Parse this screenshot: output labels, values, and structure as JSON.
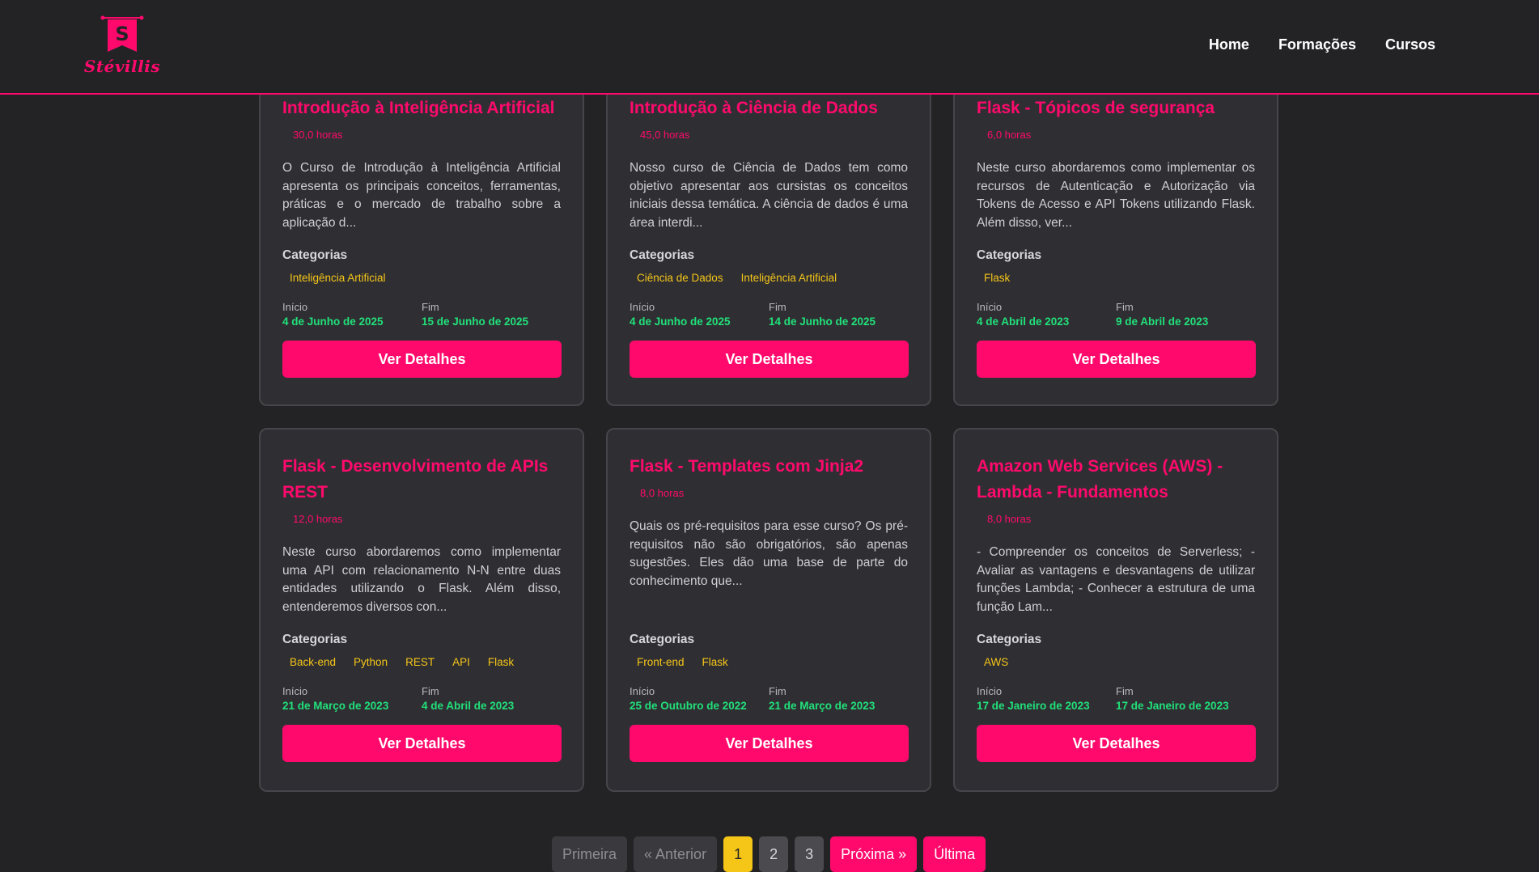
{
  "brand": {
    "name": "Stévillis",
    "letter": "S",
    "color": "#ff0a6c"
  },
  "nav": {
    "items": [
      "Home",
      "Formações",
      "Cursos"
    ]
  },
  "labels": {
    "categorias": "Categorias",
    "inicio": "Início",
    "fim": "Fim",
    "button": "Ver Detalhes"
  },
  "courses": [
    {
      "title": "Introdução à Inteligência Artificial",
      "hours": "30,0 horas",
      "description": "O Curso de Introdução à Inteligência Artificial apresenta os principais conceitos, ferramentas, práticas e o mercado de trabalho sobre a aplicação d...",
      "categories": [
        "Inteligência Artificial"
      ],
      "start": "4 de Junho de 2025",
      "end": "15 de Junho de 2025"
    },
    {
      "title": "Introdução à Ciência de Dados",
      "hours": "45,0 horas",
      "description": "Nosso curso de Ciência de Dados tem como objetivo apresentar aos cursistas os conceitos iniciais dessa temática. A ciência de dados é uma área interdi...",
      "categories": [
        "Ciência de Dados",
        "Inteligência Artificial"
      ],
      "start": "4 de Junho de 2025",
      "end": "14 de Junho de 2025"
    },
    {
      "title": "Flask - Tópicos de segurança",
      "hours": "6,0 horas",
      "description": "Neste curso abordaremos como implementar os recursos de Autenticação e Autorização via Tokens de Acesso e API Tokens utilizando Flask. Além disso, ver...",
      "categories": [
        "Flask"
      ],
      "start": "4 de Abril de 2023",
      "end": "9 de Abril de 2023"
    },
    {
      "title": "Flask - Desenvolvimento de APIs REST",
      "hours": "12,0 horas",
      "description": "Neste curso abordaremos como implementar uma API com relacionamento N-N entre duas entidades utilizando o Flask. Além disso, entenderemos diversos con...",
      "categories": [
        "Back-end",
        "Python",
        "REST",
        "API",
        "Flask"
      ],
      "start": "21 de Março de 2023",
      "end": "4 de Abril de 2023"
    },
    {
      "title": "Flask - Templates com Jinja2",
      "hours": "8,0 horas",
      "description": "Quais os pré-requisitos para esse curso? Os pré-requisitos não são obrigatórios, são apenas sugestões. Eles dão uma base de parte do conhecimento que...",
      "categories": [
        "Front-end",
        "Flask"
      ],
      "start": "25 de Outubro de 2022",
      "end": "21 de Março de 2023"
    },
    {
      "title": "Amazon Web Services (AWS) - Lambda - Fundamentos",
      "hours": "8,0 horas",
      "description": "- Compreender os conceitos de Serverless; - Avaliar as vantagens e desvantagens de utilizar funções Lambda; - Conhecer a estrutura de uma função Lam...",
      "categories": [
        "AWS"
      ],
      "start": "17 de Janeiro de 2023",
      "end": "17 de Janeiro de 2023"
    }
  ],
  "pagination": {
    "first": "Primeira",
    "prev": "« Anterior",
    "pages": [
      "1",
      "2",
      "3"
    ],
    "current": "1",
    "next": "Próxima »",
    "last": "Última"
  },
  "colors": {
    "background": "#232325",
    "card": "#2f2f33",
    "accent": "#ff0a6c",
    "tag": "#f5c518",
    "date": "#21e07a"
  }
}
